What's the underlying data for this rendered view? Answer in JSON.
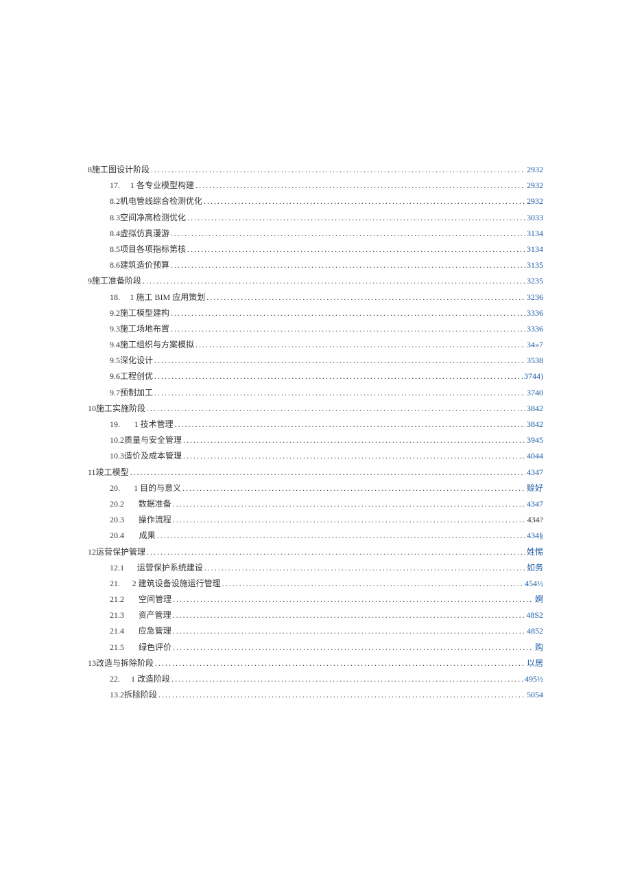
{
  "toc": [
    {
      "level": 0,
      "prefix": "8 ",
      "label": "施工图设计阶段 ",
      "page": "2932",
      "link": true
    },
    {
      "level": 1,
      "prefix": "17.",
      "gap": true,
      "label": "1 各专业模型构建",
      "page": "2932",
      "link": true
    },
    {
      "level": 1,
      "prefix": "8.2 ",
      "label": "机电管线综合检测优化 ",
      "page": "2932",
      "link": true
    },
    {
      "level": 1,
      "prefix": "8.3 ",
      "label": "空间净高检测优化 ",
      "page": "3033",
      "link": true
    },
    {
      "level": 1,
      "prefix": "8.4 ",
      "label": "虚拟仿真漫游 ",
      "page": "3134",
      "link": true
    },
    {
      "level": 1,
      "prefix": "8.5 ",
      "label": "项目各项指标第核 ",
      "page": "3134",
      "link": true
    },
    {
      "level": 1,
      "prefix": "8.6 ",
      "label": "建筑造价预算 ",
      "page": "3135",
      "link": true
    },
    {
      "level": 0,
      "prefix": "9 ",
      "label": "施工准备阶段 ",
      "page": "3235",
      "link": true
    },
    {
      "level": 1,
      "prefix": "18.",
      "gap": true,
      "label": "1 施工 BIM 应用策划 ",
      "page": "3236",
      "link": true
    },
    {
      "level": 1,
      "prefix": "9.2 ",
      "label": "施工模型建构 ",
      "page": "3336",
      "link": true
    },
    {
      "level": 1,
      "prefix": "9.3 ",
      "label": "施工场地布置 ",
      "page": "3336",
      "link": true
    },
    {
      "level": 1,
      "prefix": "9.4 ",
      "label": "施工组织与方案模拟 ",
      "page": "34»7",
      "link": true
    },
    {
      "level": 1,
      "prefix": "9.5 ",
      "label": "深化设计 ",
      "page": "3538",
      "link": true
    },
    {
      "level": 1,
      "prefix": "9.6 ",
      "label": "工程创优",
      "page": "3744)",
      "link": true
    },
    {
      "level": 1,
      "prefix": "9.7 ",
      "label": "预制加工 ",
      "page": "3740",
      "link": true
    },
    {
      "level": 0,
      "prefix": "10 ",
      "label": "施工实施阶段 ",
      "page": "3842",
      "link": true
    },
    {
      "level": 1,
      "prefix": "19.",
      "bigGap": true,
      "label": "1 技术管理 ",
      "page": "3842",
      "link": true
    },
    {
      "level": 1,
      "prefix": "10.2 ",
      "label": "质量与安全管理 ",
      "page": "3945",
      "link": true
    },
    {
      "level": 1,
      "prefix": "10.3 ",
      "label": "造价及成本管理 ",
      "page": "4044",
      "link": true
    },
    {
      "level": 0,
      "prefix": "11 ",
      "label": "竣工模型 ",
      "page": "4347",
      "link": true
    },
    {
      "level": 2,
      "prefix": "20.",
      "bigGap": true,
      "label": "1 目的与意义 ",
      "page": "赊好",
      "link": true
    },
    {
      "level": 2,
      "prefix": "20.2",
      "bigGap": true,
      "label": "数据准备 ",
      "page": "4347",
      "link": true
    },
    {
      "level": 2,
      "prefix": "20.3",
      "bigGap": true,
      "label": "操作流程 ",
      "page": "434?",
      "link": false
    },
    {
      "level": 2,
      "prefix": "20.4",
      "bigGap": true,
      "label": "成果",
      "page": "434§",
      "link": true
    },
    {
      "level": 0,
      "prefix": "12 ",
      "label": "运营保护管理 ",
      "page": "姓惕",
      "link": true
    },
    {
      "level": 2,
      "prefix": "12.1",
      "bigGap": true,
      "label": "运营保护系统建设 ",
      "page": "如务",
      "link": true
    },
    {
      "level": 2,
      "prefix": "21.",
      "bigGap": true,
      "label": "2 建筑设备设施运行管理 ",
      "page": "454½",
      "link": true
    },
    {
      "level": 2,
      "prefix": "21.2",
      "bigGap": true,
      "label": "空间管理 ",
      "page": "婀",
      "link": true
    },
    {
      "level": 2,
      "prefix": "21.3",
      "bigGap": true,
      "label": "资产管理",
      "page": "48S2",
      "link": true
    },
    {
      "level": 2,
      "prefix": "21.4",
      "bigGap": true,
      "label": "应急管理 ",
      "page": "4852",
      "link": true
    },
    {
      "level": 2,
      "prefix": "21.5",
      "bigGap": true,
      "label": "绿色评价 ",
      "page": "购",
      "link": true
    },
    {
      "level": 0,
      "prefix": "13 ",
      "label": "改造与拆除阶段 ",
      "page": "以居",
      "link": true
    },
    {
      "level": 1,
      "prefix": "22.",
      "gap": true,
      "label": "1 改造阶段 ",
      "page": "495½",
      "link": true
    },
    {
      "level": 1,
      "prefix": "13.2 ",
      "label": "拆除阶段 ",
      "page": "5054",
      "link": true
    }
  ]
}
